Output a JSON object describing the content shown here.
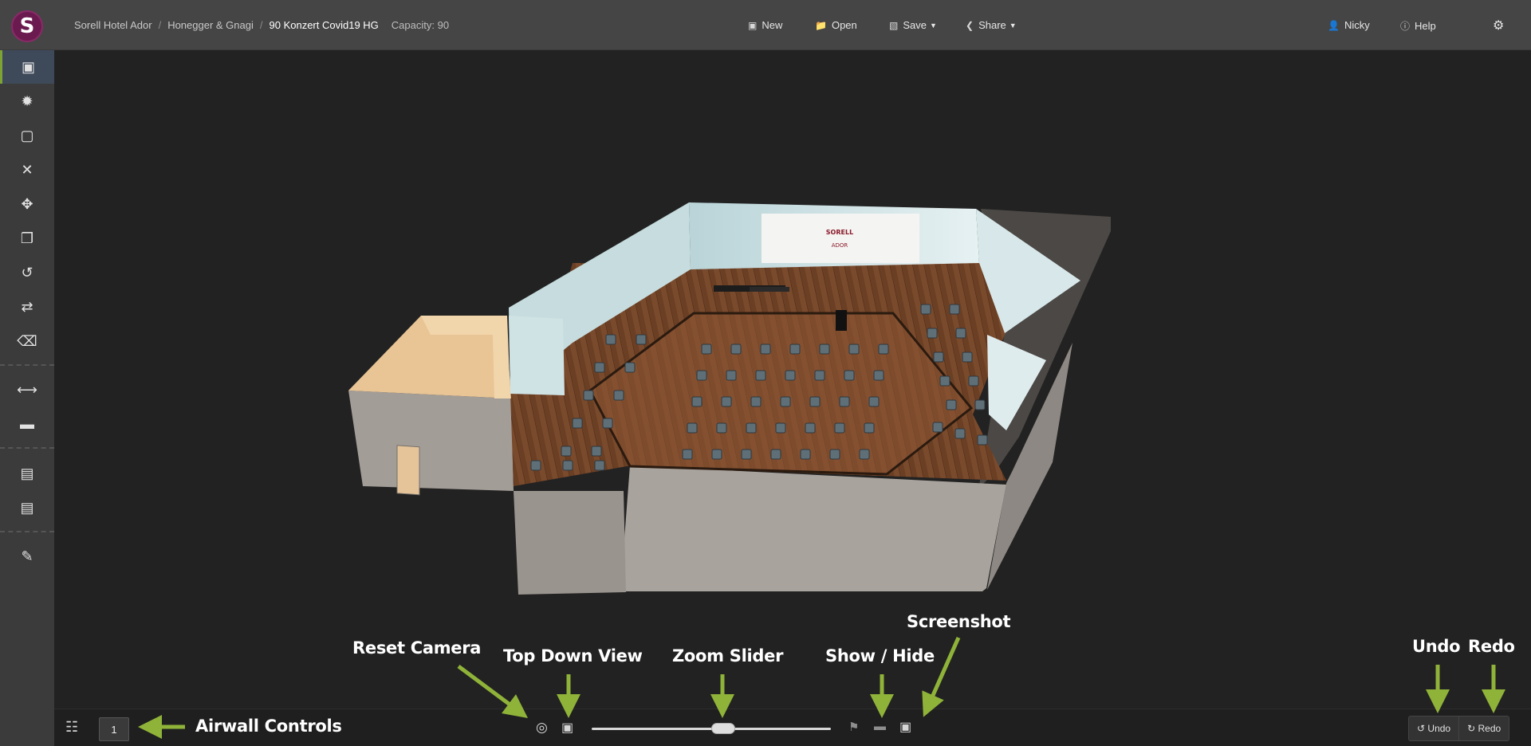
{
  "app": {
    "logo_letter": "S",
    "accent": "#7da334",
    "brand": "#6b1a4f"
  },
  "breadcrumb": {
    "items": [
      "Sorell Hotel Ador",
      "Honegger & Gnagi",
      "90 Konzert Covid19 HG"
    ],
    "capacity": "Capacity: 90"
  },
  "toolbar": {
    "new_label": "New",
    "open_label": "Open",
    "save_label": "Save",
    "share_label": "Share"
  },
  "user": {
    "name": "Nicky",
    "help_label": "Help"
  },
  "sidebar": {
    "items": [
      {
        "icon": "cube-icon",
        "active": true
      },
      {
        "icon": "wand-icon"
      },
      {
        "icon": "select-box-icon"
      },
      {
        "icon": "close-icon"
      },
      {
        "icon": "move-icon"
      },
      {
        "icon": "copy-icon"
      },
      {
        "icon": "rotate-icon"
      },
      {
        "icon": "swap-icon"
      },
      {
        "icon": "trash-icon"
      },
      {
        "icon": "resize-horizontal-icon"
      },
      {
        "icon": "ruler-icon"
      },
      {
        "icon": "align-center-icon"
      },
      {
        "icon": "align-middle-icon"
      },
      {
        "icon": "edit-icon"
      }
    ]
  },
  "bottom": {
    "floor_value": "1",
    "undo_label": "Undo",
    "redo_label": "Redo",
    "zoom_value": 0.55
  },
  "screen": {
    "line1": "SORELL",
    "line2": "ADOR"
  },
  "annotations": {
    "airwall": "Airwall Controls",
    "reset_camera": "Reset Camera",
    "top_down": "Top Down View",
    "zoom": "Zoom Slider",
    "show_hide": "Show / Hide",
    "screenshot": "Screenshot",
    "undo": "Undo",
    "redo": "Redo"
  }
}
